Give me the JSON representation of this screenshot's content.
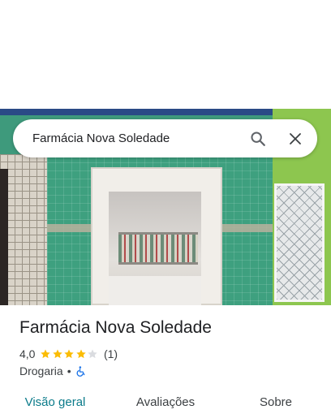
{
  "search": {
    "query": "Farmácia Nova Soledade"
  },
  "place": {
    "name": "Farmácia Nova Soledade",
    "rating": "4,0",
    "stars_filled": 4,
    "stars_total": 5,
    "review_count": "(1)",
    "category": "Drogaria",
    "separator": "•"
  },
  "tabs": [
    {
      "label": "Visão geral",
      "active": true
    },
    {
      "label": "Avaliações",
      "active": false
    },
    {
      "label": "Sobre",
      "active": false
    }
  ],
  "colors": {
    "star_filled": "#fbbc04",
    "star_empty": "#dadce0",
    "active_tab": "#0b7b8a",
    "accessibility_icon": "#1a73e8"
  },
  "icons": {
    "search": "search-icon",
    "close": "close-icon",
    "accessibility": "wheelchair-accessible-icon"
  }
}
